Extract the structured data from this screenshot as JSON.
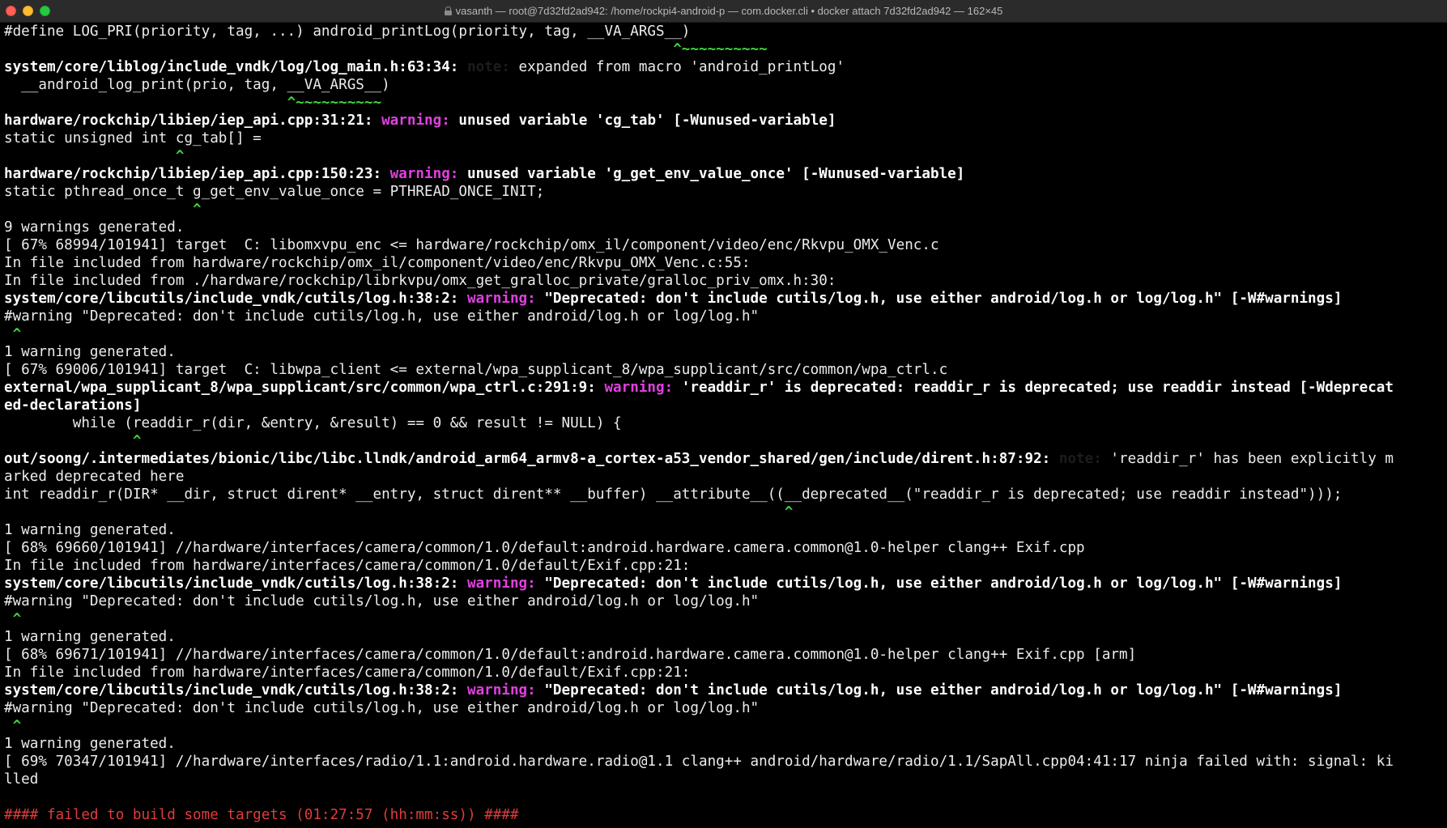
{
  "window": {
    "title": "vasanth — root@7d32fd2ad942: /home/rockpi4-android-p — com.docker.cli • docker attach 7d32fd2ad942 — 162×45"
  },
  "colors": {
    "background": "#000000",
    "warning": "#e040e0",
    "caret": "#3ed63e",
    "error": "#e23b3b",
    "text": "#ececec"
  },
  "terminal": {
    "lines": [
      [
        {
          "t": "#define LOG_PRI(priority, tag, ...) android_printLog(priority, tag, __VA_ARGS__)",
          "s": "plain"
        }
      ],
      [
        {
          "t": "                                                                              ",
          "s": "plain"
        },
        {
          "t": "^~~~~~~~~~~",
          "s": "tilde"
        }
      ],
      [
        {
          "t": "system/core/liblog/include_vndk/log/log_main.h:63:34: ",
          "s": "bold"
        },
        {
          "t": "note:",
          "s": "note"
        },
        {
          "t": " expanded from macro 'android_printLog'",
          "s": "plain"
        }
      ],
      [
        {
          "t": "  __android_log_print(prio, tag, __VA_ARGS__)",
          "s": "plain"
        }
      ],
      [
        {
          "t": "                                 ",
          "s": "plain"
        },
        {
          "t": "^~~~~~~~~~~",
          "s": "tilde"
        }
      ],
      [
        {
          "t": "hardware/rockchip/libiep/iep_api.cpp:31:21: ",
          "s": "bold"
        },
        {
          "t": "warning:",
          "s": "warning"
        },
        {
          "t": " unused variable 'cg_tab' [-Wunused-variable]",
          "s": "bold"
        }
      ],
      [
        {
          "t": "static unsigned int cg_tab[] =",
          "s": "plain"
        }
      ],
      [
        {
          "t": "                    ",
          "s": "plain"
        },
        {
          "t": "^",
          "s": "caret"
        }
      ],
      [
        {
          "t": "hardware/rockchip/libiep/iep_api.cpp:150:23: ",
          "s": "bold"
        },
        {
          "t": "warning:",
          "s": "warning"
        },
        {
          "t": " unused variable 'g_get_env_value_once' [-Wunused-variable]",
          "s": "bold"
        }
      ],
      [
        {
          "t": "static pthread_once_t g_get_env_value_once = PTHREAD_ONCE_INIT;",
          "s": "plain"
        }
      ],
      [
        {
          "t": "                      ",
          "s": "plain"
        },
        {
          "t": "^",
          "s": "caret"
        }
      ],
      [
        {
          "t": "9 warnings generated.",
          "s": "plain"
        }
      ],
      [
        {
          "t": "[ 67% 68994/101941] target  C: libomxvpu_enc <= hardware/rockchip/omx_il/component/video/enc/Rkvpu_OMX_Venc.c",
          "s": "plain"
        }
      ],
      [
        {
          "t": "In file included from hardware/rockchip/omx_il/component/video/enc/Rkvpu_OMX_Venc.c:55:",
          "s": "plain"
        }
      ],
      [
        {
          "t": "In file included from ./hardware/rockchip/librkvpu/omx_get_gralloc_private/gralloc_priv_omx.h:30:",
          "s": "plain"
        }
      ],
      [
        {
          "t": "system/core/libcutils/include_vndk/cutils/log.h:38:2: ",
          "s": "bold"
        },
        {
          "t": "warning:",
          "s": "warning"
        },
        {
          "t": " \"Deprecated: don't include cutils/log.h, use either android/log.h or log/log.h\" [-W#warnings]",
          "s": "bold"
        }
      ],
      [
        {
          "t": "#warning \"Deprecated: don't include cutils/log.h, use either android/log.h or log/log.h\"",
          "s": "plain"
        }
      ],
      [
        {
          "t": " ",
          "s": "plain"
        },
        {
          "t": "^",
          "s": "caret"
        }
      ],
      [
        {
          "t": "1 warning generated.",
          "s": "plain"
        }
      ],
      [
        {
          "t": "[ 67% 69006/101941] target  C: libwpa_client <= external/wpa_supplicant_8/wpa_supplicant/src/common/wpa_ctrl.c",
          "s": "plain"
        }
      ],
      [
        {
          "t": "external/wpa_supplicant_8/wpa_supplicant/src/common/wpa_ctrl.c:291:9: ",
          "s": "bold"
        },
        {
          "t": "warning:",
          "s": "warning"
        },
        {
          "t": " 'readdir_r' is deprecated: readdir_r is deprecated; use readdir instead [-Wdeprecat",
          "s": "bold"
        }
      ],
      [
        {
          "t": "ed-declarations]",
          "s": "bold"
        }
      ],
      [
        {
          "t": "        while (readdir_r(dir, &entry, &result) == 0 && result != NULL) {",
          "s": "plain"
        }
      ],
      [
        {
          "t": "               ",
          "s": "plain"
        },
        {
          "t": "^",
          "s": "caret"
        }
      ],
      [
        {
          "t": "out/soong/.intermediates/bionic/libc/libc.llndk/android_arm64_armv8-a_cortex-a53_vendor_shared/gen/include/dirent.h:87:92: ",
          "s": "bold"
        },
        {
          "t": "note:",
          "s": "note"
        },
        {
          "t": " 'readdir_r' has been explicitly m",
          "s": "plain"
        }
      ],
      [
        {
          "t": "arked deprecated here",
          "s": "plain"
        }
      ],
      [
        {
          "t": "int readdir_r(DIR* __dir, struct dirent* __entry, struct dirent** __buffer) __attribute__((__deprecated__(\"readdir_r is deprecated; use readdir instead\")));",
          "s": "plain"
        }
      ],
      [
        {
          "t": "                                                                                           ",
          "s": "plain"
        },
        {
          "t": "^",
          "s": "caret"
        }
      ],
      [
        {
          "t": "1 warning generated.",
          "s": "plain"
        }
      ],
      [
        {
          "t": "[ 68% 69660/101941] //hardware/interfaces/camera/common/1.0/default:android.hardware.camera.common@1.0-helper clang++ Exif.cpp",
          "s": "plain"
        }
      ],
      [
        {
          "t": "In file included from hardware/interfaces/camera/common/1.0/default/Exif.cpp:21:",
          "s": "plain"
        }
      ],
      [
        {
          "t": "system/core/libcutils/include_vndk/cutils/log.h:38:2: ",
          "s": "bold"
        },
        {
          "t": "warning:",
          "s": "warning"
        },
        {
          "t": " \"Deprecated: don't include cutils/log.h, use either android/log.h or log/log.h\" [-W#warnings]",
          "s": "bold"
        }
      ],
      [
        {
          "t": "#warning \"Deprecated: don't include cutils/log.h, use either android/log.h or log/log.h\"",
          "s": "plain"
        }
      ],
      [
        {
          "t": " ",
          "s": "plain"
        },
        {
          "t": "^",
          "s": "caret"
        }
      ],
      [
        {
          "t": "1 warning generated.",
          "s": "plain"
        }
      ],
      [
        {
          "t": "[ 68% 69671/101941] //hardware/interfaces/camera/common/1.0/default:android.hardware.camera.common@1.0-helper clang++ Exif.cpp [arm]",
          "s": "plain"
        }
      ],
      [
        {
          "t": "In file included from hardware/interfaces/camera/common/1.0/default/Exif.cpp:21:",
          "s": "plain"
        }
      ],
      [
        {
          "t": "system/core/libcutils/include_vndk/cutils/log.h:38:2: ",
          "s": "bold"
        },
        {
          "t": "warning:",
          "s": "warning"
        },
        {
          "t": " \"Deprecated: don't include cutils/log.h, use either android/log.h or log/log.h\" [-W#warnings]",
          "s": "bold"
        }
      ],
      [
        {
          "t": "#warning \"Deprecated: don't include cutils/log.h, use either android/log.h or log/log.h\"",
          "s": "plain"
        }
      ],
      [
        {
          "t": " ",
          "s": "plain"
        },
        {
          "t": "^",
          "s": "caret"
        }
      ],
      [
        {
          "t": "1 warning generated.",
          "s": "plain"
        }
      ],
      [
        {
          "t": "[ 69% 70347/101941] //hardware/interfaces/radio/1.1:android.hardware.radio@1.1 clang++ android/hardware/radio/1.1/SapAll.cpp04:41:17 ninja failed with: signal: ki",
          "s": "plain"
        }
      ],
      [
        {
          "t": "lled",
          "s": "plain"
        }
      ],
      [
        {
          "t": "",
          "s": "plain"
        }
      ],
      [
        {
          "t": "#### failed to build some targets (01:27:57 (hh:mm:ss)) ####",
          "s": "error"
        }
      ]
    ]
  }
}
